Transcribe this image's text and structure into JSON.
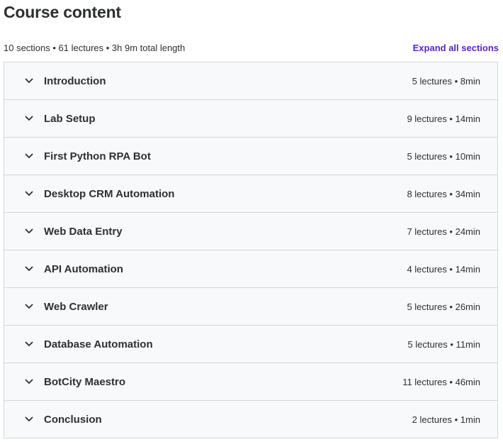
{
  "header": {
    "title": "Course content",
    "summary": "10 sections • 61 lectures • 3h 9m total length",
    "expand_label": "Expand all sections"
  },
  "colors": {
    "accent": "#5624d0",
    "text": "#2d2f31",
    "section_bg": "#f7f9fa",
    "border": "#d1d7dc"
  },
  "sections": [
    {
      "title": "Introduction",
      "meta": "5 lectures • 8min",
      "icon": "chevron-down-icon"
    },
    {
      "title": "Lab Setup",
      "meta": "9 lectures • 14min",
      "icon": "chevron-down-icon"
    },
    {
      "title": "First Python RPA Bot",
      "meta": "5 lectures • 10min",
      "icon": "chevron-down-icon"
    },
    {
      "title": "Desktop CRM Automation",
      "meta": "8 lectures • 34min",
      "icon": "chevron-down-icon"
    },
    {
      "title": "Web Data Entry",
      "meta": "7 lectures • 24min",
      "icon": "chevron-down-icon"
    },
    {
      "title": "API Automation",
      "meta": "4 lectures • 14min",
      "icon": "chevron-down-icon"
    },
    {
      "title": "Web Crawler",
      "meta": "5 lectures • 26min",
      "icon": "chevron-down-icon"
    },
    {
      "title": "Database Automation",
      "meta": "5 lectures • 11min",
      "icon": "chevron-down-icon"
    },
    {
      "title": "BotCity Maestro",
      "meta": "11 lectures • 46min",
      "icon": "chevron-down-icon"
    },
    {
      "title": "Conclusion",
      "meta": "2 lectures • 1min",
      "icon": "chevron-down-icon"
    }
  ]
}
